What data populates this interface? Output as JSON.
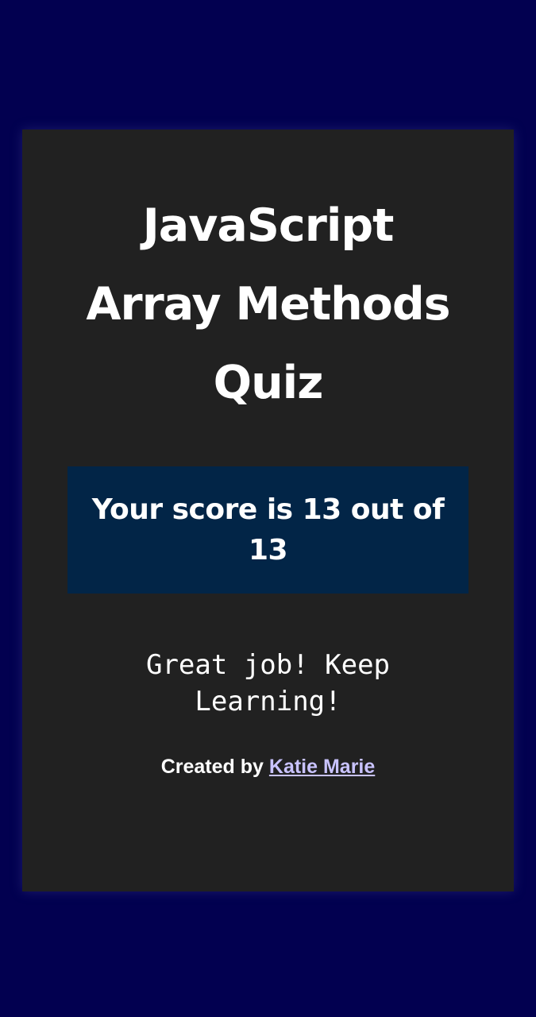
{
  "quiz": {
    "title_lines": [
      "JavaScript",
      "Array Methods",
      "Quiz"
    ],
    "score": {
      "label": "Your score is 13 out of 13",
      "value": 13,
      "total": 13
    },
    "message_lines": [
      "Great job! Keep",
      "Learning!"
    ],
    "credit": {
      "prefix": "Created by",
      "author": "Katie Marie"
    }
  },
  "colors": {
    "background": "#020050",
    "card": "#212121",
    "score_box": "#022547",
    "link": "#c9c3ff"
  }
}
